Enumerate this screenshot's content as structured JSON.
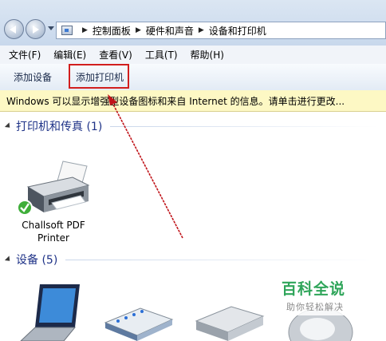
{
  "breadcrumb": [
    "控制面板",
    "硬件和声音",
    "设备和打印机"
  ],
  "menu": [
    "文件(F)",
    "编辑(E)",
    "查看(V)",
    "工具(T)",
    "帮助(H)"
  ],
  "commands": {
    "add_device": "添加设备",
    "add_printer": "添加打印机"
  },
  "infobar": {
    "text": "Windows 可以显示增强型设备图标和来自 Internet 的信息。请单击进行更改..."
  },
  "groups": {
    "printers": {
      "title": "打印机和传真 (1)"
    },
    "devices": {
      "title": "设备 (5)"
    }
  },
  "printer": {
    "line1": "Challsoft PDF",
    "line2": "Printer",
    "status_icon": "green-check-icon"
  },
  "devices": [
    "laptop-icon",
    "router-icon",
    "hard-drive-icon",
    "mouse-icon"
  ],
  "watermark": {
    "title": "百科全说",
    "subtitle": "助你轻松解决"
  },
  "colors": {
    "highlight": "#d21e1e",
    "arrow": "#c0141a",
    "group_title": "#1e3287",
    "infobar_bg": "#fdf8c4"
  }
}
